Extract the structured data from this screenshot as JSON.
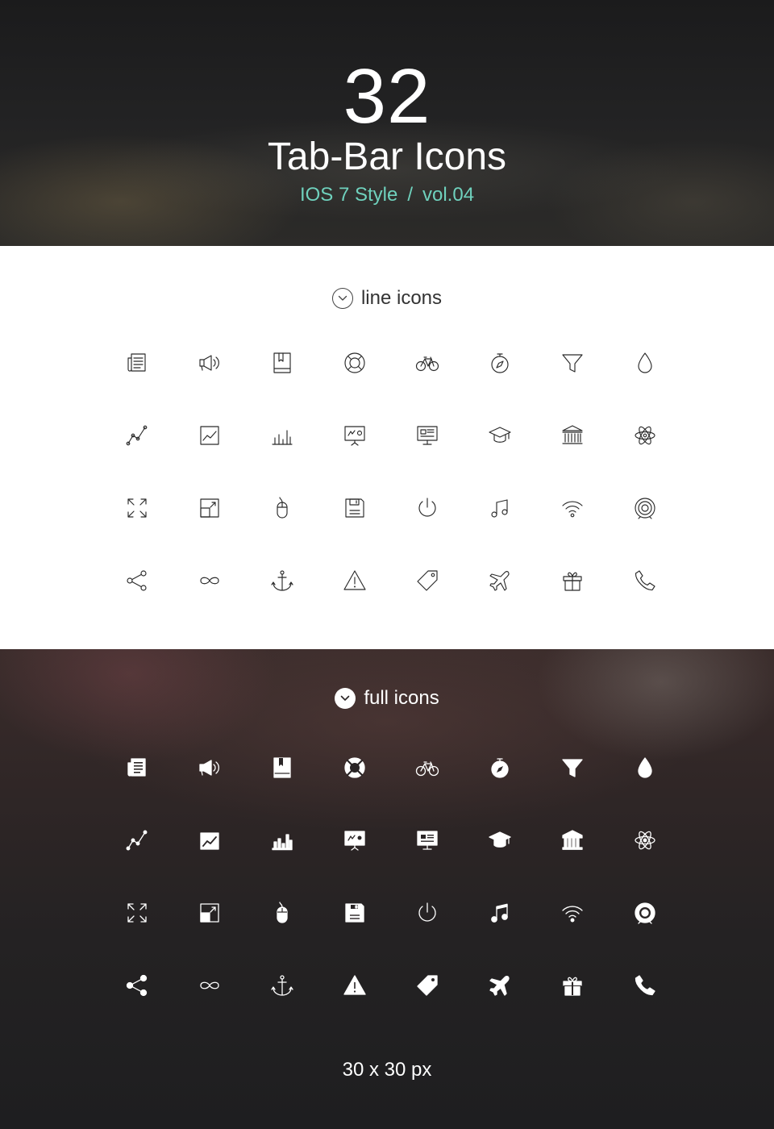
{
  "hero": {
    "count": "32",
    "title": "Tab-Bar Icons",
    "subtitle_style": "IOS 7 Style",
    "subtitle_separator": "/",
    "subtitle_volume": "vol.04",
    "accent_color": "#6fd1bd"
  },
  "sections": {
    "line": {
      "label": "line icons",
      "chevron_icon": "chevron-down-icon"
    },
    "full": {
      "label": "full icons",
      "chevron_icon": "chevron-down-icon"
    }
  },
  "icons": [
    "newspaper-icon",
    "megaphone-icon",
    "book-icon",
    "lifebuoy-icon",
    "bicycle-icon",
    "compass-icon",
    "funnel-icon",
    "drop-icon",
    "line-chart-icon",
    "area-chart-icon",
    "bar-chart-icon",
    "presentation-chart-icon",
    "presentation-board-icon",
    "graduation-cap-icon",
    "bank-icon",
    "atom-icon",
    "expand-icon",
    "resize-icon",
    "mouse-icon",
    "floppy-disk-icon",
    "power-icon",
    "music-note-icon",
    "wifi-icon",
    "target-icon",
    "share-icon",
    "infinity-icon",
    "anchor-icon",
    "warning-icon",
    "tag-icon",
    "airplane-icon",
    "gift-icon",
    "phone-icon"
  ],
  "footer": {
    "size_label": "30 x 30 px"
  }
}
